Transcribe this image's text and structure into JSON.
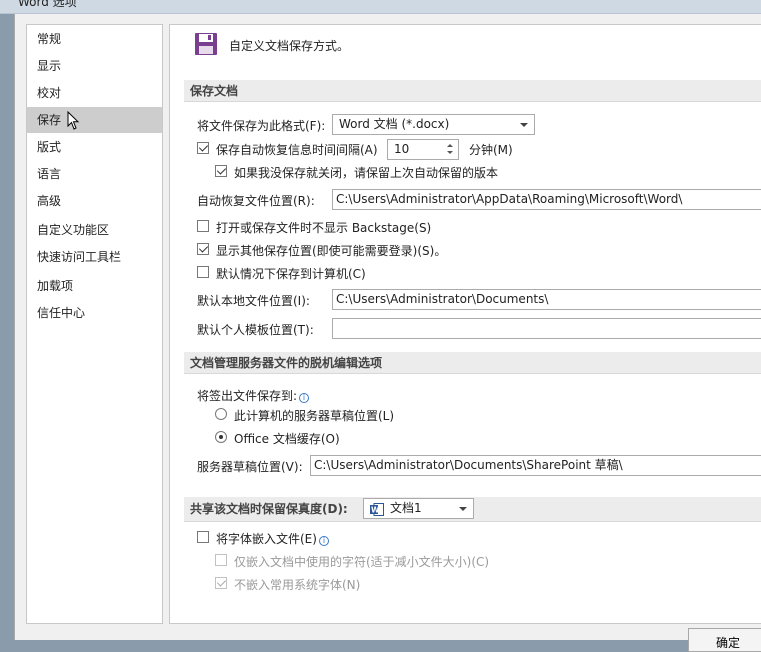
{
  "window": {
    "title": "Word 选项"
  },
  "sidebar": {
    "items": [
      {
        "label": "常规"
      },
      {
        "label": "显示"
      },
      {
        "label": "校对"
      },
      {
        "label": "保存"
      },
      {
        "label": "版式"
      },
      {
        "label": "语言"
      },
      {
        "label": "高级"
      },
      {
        "label": "自定义功能区"
      },
      {
        "label": "快速访问工具栏"
      },
      {
        "label": "加载项"
      },
      {
        "label": "信任中心"
      }
    ],
    "selected": "保存"
  },
  "header": {
    "title": "自定义文档保存方式。"
  },
  "save_docs": {
    "section_title": "保存文档",
    "format_label": "将文件保存为此格式(F):",
    "format_value": "Word 文档 (*.docx)",
    "autorecover_label": "保存自动恢复信息时间间隔(A)",
    "autorecover_minutes": "10",
    "minutes_unit": "分钟(M)",
    "keep_last_label": "如果我没保存就关闭，请保留上次自动保留的版本",
    "autorecover_location_label": "自动恢复文件位置(R):",
    "autorecover_location_value": "C:\\Users\\Administrator\\AppData\\Roaming\\Microsoft\\Word\\",
    "no_backstage_label": "打开或保存文件时不显示 Backstage(S)",
    "show_other_label": "显示其他保存位置(即使可能需要登录)(S)。",
    "default_computer_label": "默认情况下保存到计算机(C)",
    "local_location_label": "默认本地文件位置(I):",
    "local_location_value": "C:\\Users\\Administrator\\Documents\\",
    "template_location_label": "默认个人模板位置(T):",
    "template_location_value": ""
  },
  "offline": {
    "section_title": "文档管理服务器文件的脱机编辑选项",
    "checkout_label": "将签出文件保存到:",
    "option_server_label": "此计算机的服务器草稿位置(L)",
    "option_cache_label": "Office 文档缓存(O)",
    "drafts_label": "服务器草稿位置(V):",
    "drafts_value": "C:\\Users\\Administrator\\Documents\\SharePoint 草稿\\"
  },
  "fidelity": {
    "section_title": "共享该文档时保留保真度(D):",
    "doc_value": "文档1",
    "embed_fonts_label": "将字体嵌入文件(E)",
    "embed_used_label": "仅嵌入文档中使用的字符(适于减小文件大小)(C)",
    "no_common_label": "不嵌入常用系统字体(N)"
  },
  "footer": {
    "ok_label": "确定"
  },
  "colors": {
    "accent": "#7b3f8f",
    "selected_bg": "#cdcdcd",
    "word_blue": "#2b5797"
  }
}
